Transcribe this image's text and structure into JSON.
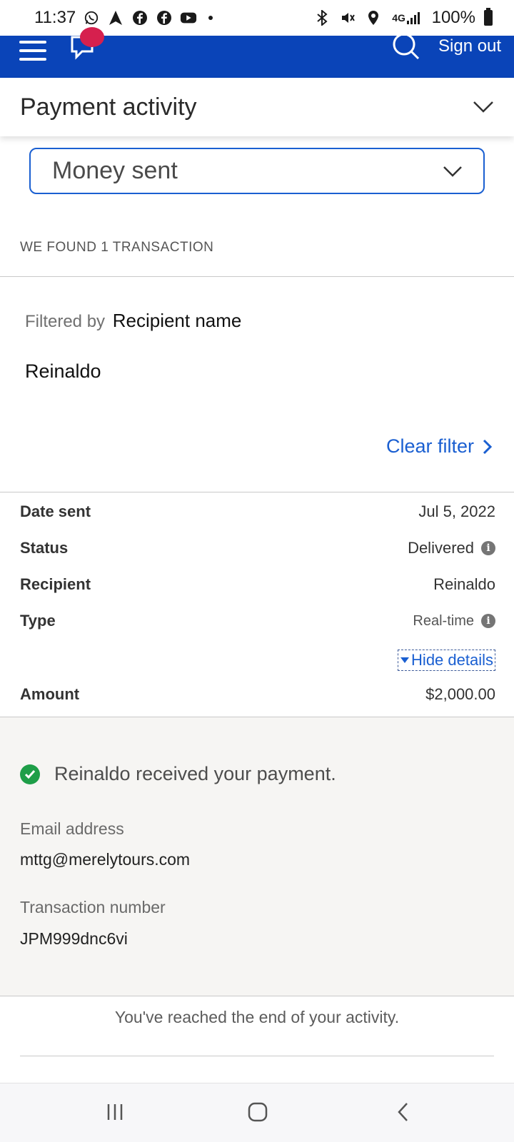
{
  "status_bar": {
    "time": "11:37",
    "network": "4G",
    "battery": "100%"
  },
  "header": {
    "sign_out_label": "Sign out",
    "brand_color": "#0a44b8",
    "badge_color": "#d6204e"
  },
  "section": {
    "title": "Payment activity"
  },
  "filter_dropdown": {
    "selected": "Money sent"
  },
  "results": {
    "count_text": "WE FOUND 1 TRANSACTION",
    "filtered_by_label": "Filtered by",
    "filter_field": "Recipient name",
    "filter_value": "Reinaldo",
    "clear_filter_label": "Clear filter"
  },
  "transaction": {
    "date_label": "Date sent",
    "date_value": "Jul 5, 2022",
    "status_label": "Status",
    "status_value": "Delivered",
    "recipient_label": "Recipient",
    "recipient_value": "Reinaldo",
    "type_label": "Type",
    "type_value": "Real-time",
    "hide_details_label": "Hide details",
    "amount_label": "Amount",
    "amount_value": "$2,000.00"
  },
  "details": {
    "confirmation": "Reinaldo received your payment.",
    "email_label": "Email address",
    "email_value": "mttg@merelytours.com",
    "txn_label": "Transaction number",
    "txn_value": "JPM999dnc6vi"
  },
  "footer": {
    "end_text": "You've reached the end of your activity."
  },
  "icons": [
    "whatsapp-icon",
    "navigation-icon",
    "facebook-icon",
    "youtube-icon",
    "bluetooth-icon",
    "mute-icon",
    "location-icon",
    "signal-icon",
    "battery-icon",
    "menu-icon",
    "inbox-icon",
    "search-icon",
    "chevron-down-icon",
    "chevron-right-icon",
    "info-icon",
    "check-circle-icon",
    "recent-apps-icon",
    "home-icon",
    "back-icon"
  ],
  "colors": {
    "link": "#1a5fd1",
    "success": "#1e9e48"
  }
}
